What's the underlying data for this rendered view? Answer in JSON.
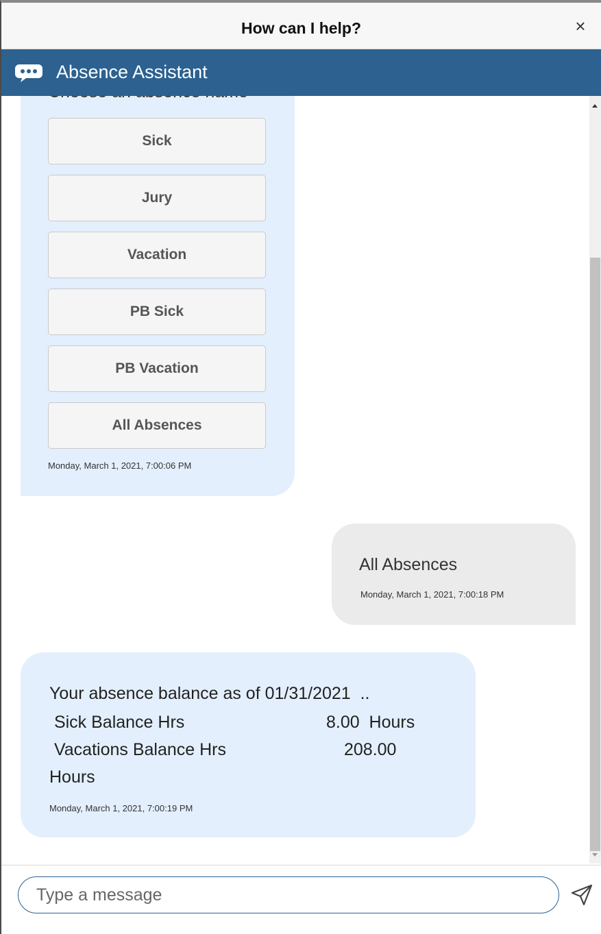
{
  "window": {
    "title": "How can I help?",
    "close_label": "×"
  },
  "assistant": {
    "name": "Absence Assistant",
    "icon": "chat-bubble-icon",
    "bar_color": "#2c6190"
  },
  "messages": {
    "options_message": {
      "prompt_cut": "Choose an absence name",
      "options": [
        "Sick",
        "Jury",
        "Vacation",
        "PB Sick",
        "PB Vacation",
        "All Absences"
      ],
      "timestamp": "Monday, March 1, 2021, 7:00:06 PM"
    },
    "user_message": {
      "text": "All Absences",
      "timestamp": "Monday, March 1, 2021, 7:00:18 PM"
    },
    "balance_message": {
      "line1": "Your absence balance as of 01/31/2021  ..",
      "line2_label": " Sick Balance Hrs",
      "line2_value": "8.00  Hours",
      "line3_label": " Vacations Balance Hrs",
      "line3_value": "208.00",
      "line4": "Hours",
      "timestamp": "Monday, March 1, 2021, 7:00:19 PM"
    }
  },
  "composer": {
    "placeholder": "Type a message",
    "send_icon": "send-icon"
  },
  "colors": {
    "bot_bubble": "#e3effd",
    "user_bubble": "#ebebeb"
  }
}
